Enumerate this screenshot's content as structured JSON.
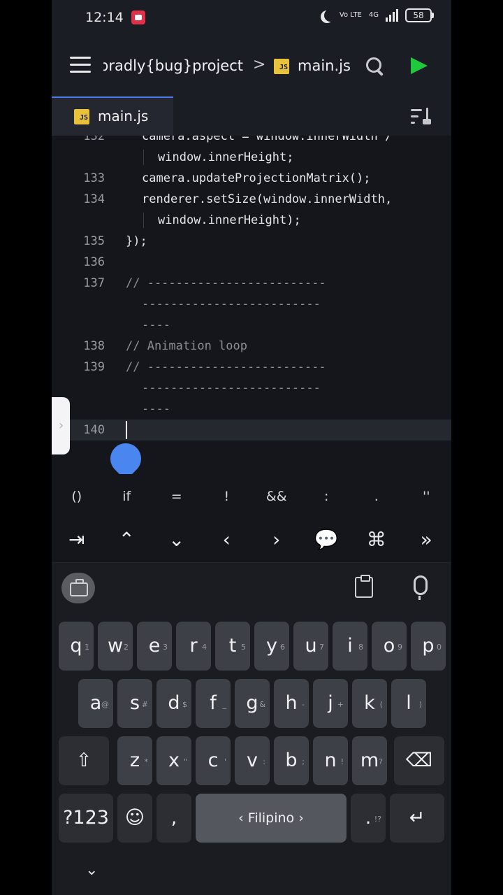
{
  "status": {
    "time": "12:14",
    "network": "Vo LTE",
    "signal": "4G",
    "battery": "58"
  },
  "header": {
    "project": "Unbradly{bug}project",
    "separator": ">",
    "file": "main.js",
    "js_badge": "JS"
  },
  "tabs": [
    {
      "label": "main.js",
      "badge": "JS"
    }
  ],
  "editor": {
    "lines": [
      {
        "num": "132",
        "text": "camera.aspect = window.innerWidth /",
        "kind": "code"
      },
      {
        "num": "",
        "text": "window.innerHeight;",
        "kind": "code"
      },
      {
        "num": "133",
        "text": "camera.updateProjectionMatrix();",
        "kind": "code"
      },
      {
        "num": "134",
        "text": "renderer.setSize(window.innerWidth,",
        "kind": "code"
      },
      {
        "num": "",
        "text": "window.innerHeight);",
        "kind": "code"
      },
      {
        "num": "135",
        "text": "});",
        "kind": "code"
      },
      {
        "num": "136",
        "text": "",
        "kind": "code"
      },
      {
        "num": "137",
        "text": "// -------------------------",
        "kind": "comment"
      },
      {
        "num": "",
        "text": "-------------------------",
        "kind": "comment"
      },
      {
        "num": "",
        "text": "----",
        "kind": "comment"
      },
      {
        "num": "138",
        "text": "// Animation loop",
        "kind": "comment"
      },
      {
        "num": "139",
        "text": "// -------------------------",
        "kind": "comment"
      },
      {
        "num": "",
        "text": "-------------------------",
        "kind": "comment"
      },
      {
        "num": "",
        "text": "----",
        "kind": "comment"
      },
      {
        "num": "140",
        "text": "",
        "kind": "code"
      }
    ]
  },
  "symbols": [
    "()",
    "if",
    "=",
    "!",
    "&&",
    ":",
    ".",
    "''"
  ],
  "navkeys": [
    "⇥",
    "⌃",
    "⌄",
    "‹",
    "›",
    "💬",
    "⌘",
    "»"
  ],
  "keyboard": {
    "row1": [
      {
        "k": "q",
        "h": "1"
      },
      {
        "k": "w",
        "h": "2"
      },
      {
        "k": "e",
        "h": "3"
      },
      {
        "k": "r",
        "h": "4"
      },
      {
        "k": "t",
        "h": "5"
      },
      {
        "k": "y",
        "h": "6"
      },
      {
        "k": "u",
        "h": "7"
      },
      {
        "k": "i",
        "h": "8"
      },
      {
        "k": "o",
        "h": "9"
      },
      {
        "k": "p",
        "h": "0"
      }
    ],
    "row2": [
      {
        "k": "a",
        "h": "@"
      },
      {
        "k": "s",
        "h": "#"
      },
      {
        "k": "d",
        "h": "$"
      },
      {
        "k": "f",
        "h": "_"
      },
      {
        "k": "g",
        "h": "&"
      },
      {
        "k": "h",
        "h": "-"
      },
      {
        "k": "j",
        "h": "+"
      },
      {
        "k": "k",
        "h": "("
      },
      {
        "k": "l",
        "h": ")"
      }
    ],
    "row3": [
      {
        "k": "z",
        "h": "*"
      },
      {
        "k": "x",
        "h": "\""
      },
      {
        "k": "c",
        "h": "'"
      },
      {
        "k": "v",
        "h": ":"
      },
      {
        "k": "b",
        "h": ";"
      },
      {
        "k": "n",
        "h": "!"
      },
      {
        "k": "m",
        "h": "?"
      }
    ],
    "shift": "⇧",
    "backspace": "⌫",
    "numbers": "?123",
    "emoji": "☺",
    "comma": ",",
    "space": "‹  Filipino  ›",
    "period": ".",
    "period_hint": "!?",
    "enter": "↵",
    "hide": "⌄"
  }
}
